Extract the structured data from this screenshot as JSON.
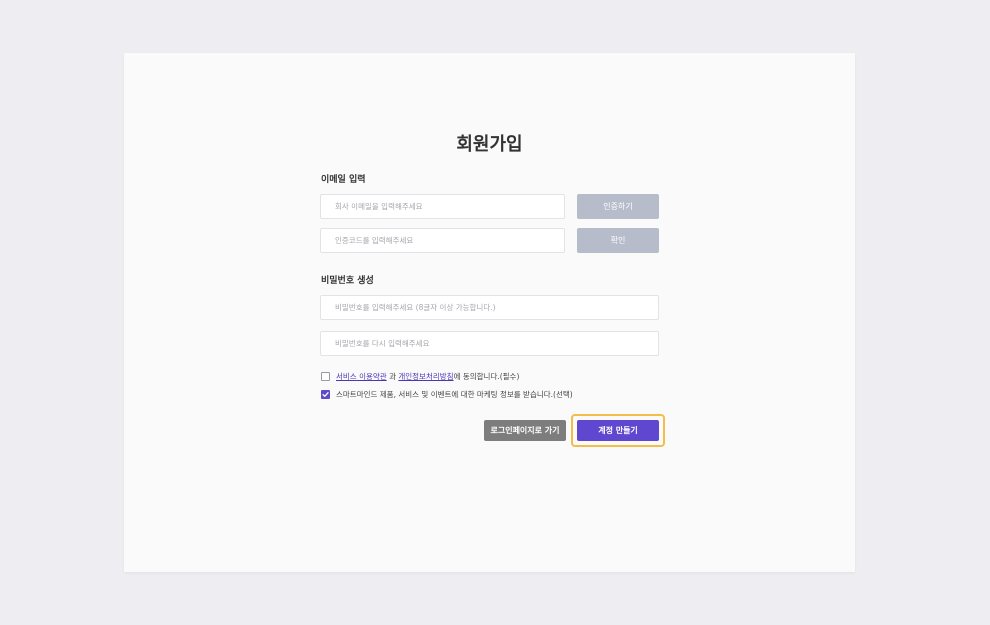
{
  "page": {
    "title": "회원가입"
  },
  "email_section": {
    "label": "이메일 입력",
    "email_placeholder": "회사 이메일을 입력해주세요",
    "verify_button": "인증하기",
    "code_placeholder": "인증코드를 입력해주세요",
    "confirm_button": "확인"
  },
  "password_section": {
    "label": "비밀번호 생성",
    "password_placeholder": "비밀번호를 입력해주세요 (8글자 이상 가능합니다.)",
    "password_confirm_placeholder": "비밀번호를 다시 입력해주세요"
  },
  "agreements": {
    "terms": {
      "checked": false,
      "link1": "서비스 이용약관",
      "connector": " 과 ",
      "link2": "개인정보처리방침",
      "suffix": "에 동의합니다.(필수)"
    },
    "marketing": {
      "checked": true,
      "text": "스마트마인드 제품, 서비스 및 이벤트에 대한 마케팅 정보를 받습니다.(선택)"
    }
  },
  "actions": {
    "login_button": "로그인페이지로 가기",
    "create_button": "계정 만들기"
  },
  "colors": {
    "accent": "#5f48cf",
    "focus_ring": "#f3bd4a",
    "disabled_button": "#b6bcca",
    "secondary_button": "#7d7d7d"
  },
  "icons": {
    "checkmark": "checkmark-icon"
  }
}
